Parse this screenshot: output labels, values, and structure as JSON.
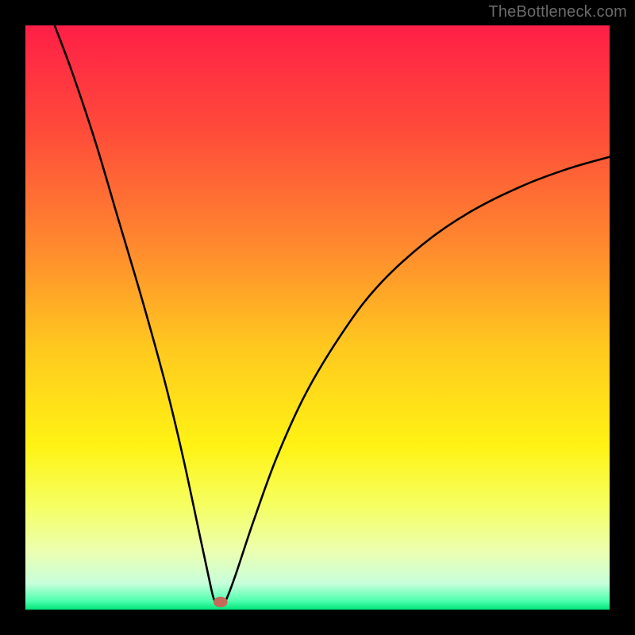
{
  "watermark": "TheBottleneck.com",
  "chart_data": {
    "type": "line",
    "title": "",
    "xlabel": "",
    "ylabel": "",
    "xlim": [
      0,
      100
    ],
    "ylim": [
      0,
      100
    ],
    "gradient_stops": [
      {
        "offset": 0.0,
        "color": "#ff1f47"
      },
      {
        "offset": 0.18,
        "color": "#ff4b3a"
      },
      {
        "offset": 0.38,
        "color": "#ff8a2e"
      },
      {
        "offset": 0.55,
        "color": "#ffc81f"
      },
      {
        "offset": 0.72,
        "color": "#fff314"
      },
      {
        "offset": 0.82,
        "color": "#f6ff60"
      },
      {
        "offset": 0.9,
        "color": "#ecffb0"
      },
      {
        "offset": 0.955,
        "color": "#c8ffdc"
      },
      {
        "offset": 0.985,
        "color": "#4fffaf"
      },
      {
        "offset": 1.0,
        "color": "#00e57a"
      }
    ],
    "curve": {
      "description": "V-shaped bottleneck curve with minimum near x≈33",
      "min_x": 33,
      "min_y": 1,
      "points": [
        {
          "x": 5.0,
          "y": 100.0
        },
        {
          "x": 8.0,
          "y": 92.0
        },
        {
          "x": 12.0,
          "y": 80.0
        },
        {
          "x": 16.0,
          "y": 66.5
        },
        {
          "x": 20.0,
          "y": 53.0
        },
        {
          "x": 24.0,
          "y": 38.5
        },
        {
          "x": 27.0,
          "y": 26.0
        },
        {
          "x": 30.0,
          "y": 12.0
        },
        {
          "x": 31.5,
          "y": 5.0
        },
        {
          "x": 32.2,
          "y": 2.0
        },
        {
          "x": 32.8,
          "y": 1.0
        },
        {
          "x": 33.8,
          "y": 1.0
        },
        {
          "x": 34.5,
          "y": 2.0
        },
        {
          "x": 36.0,
          "y": 6.0
        },
        {
          "x": 39.0,
          "y": 15.0
        },
        {
          "x": 43.0,
          "y": 26.0
        },
        {
          "x": 48.0,
          "y": 37.0
        },
        {
          "x": 54.0,
          "y": 47.0
        },
        {
          "x": 60.0,
          "y": 55.0
        },
        {
          "x": 68.0,
          "y": 62.5
        },
        {
          "x": 76.0,
          "y": 68.0
        },
        {
          "x": 85.0,
          "y": 72.5
        },
        {
          "x": 93.0,
          "y": 75.5
        },
        {
          "x": 100.0,
          "y": 77.5
        }
      ]
    },
    "marker": {
      "x": 33.4,
      "y": 1.3,
      "rx": 1.2,
      "ry": 0.9,
      "color": "#c46a5a"
    }
  }
}
